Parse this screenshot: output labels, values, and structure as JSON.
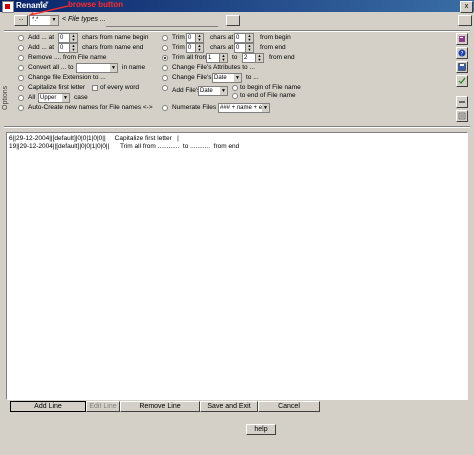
{
  "window": {
    "title": "Rename",
    "title_suffix": "*.*",
    "close": "x"
  },
  "annotation": {
    "text": "browse button"
  },
  "toolbar": {
    "browse_label": "...",
    "file_types_value": "*.*",
    "file_types_label": "< File types ..."
  },
  "options_label": "Options",
  "left_options": [
    {
      "pre": "Add ... at",
      "spin": "0",
      "post": "chars from name begin"
    },
    {
      "pre": "Add ... at",
      "spin": "0",
      "post": "chars from name end"
    },
    {
      "pre": "Remove .... from File name"
    },
    {
      "pre": "Convert all ... to",
      "combo": "",
      "post": "in name"
    },
    {
      "pre": "Change file Extension to ..."
    },
    {
      "pre": "Capitalize first letter",
      "check": "of every word"
    },
    {
      "pre": "All",
      "combo": "Upper",
      "post": "case"
    },
    {
      "pre": "Auto-Create new names for File names <->"
    }
  ],
  "right_options": [
    {
      "pre": "Trim",
      "spin": "0",
      "mid": "chars at",
      "spin2": "0",
      "post": "from begin"
    },
    {
      "pre": "Trim",
      "spin": "0",
      "mid": "chars at",
      "spin2": "0",
      "post": "from end"
    },
    {
      "pre": "Trim all from",
      "spin": "1",
      "mid": "to",
      "spin2": "2",
      "post": "from end"
    },
    {
      "pre": "Change File's Attributes to ..."
    },
    {
      "pre": "Change File's",
      "combo": "Date",
      "post": "to ..."
    },
    {
      "pre": "Add File's",
      "combo": "Date",
      "post1": "to begin of File name",
      "post2": "to end of File name"
    },
    {
      "pre": "Numerate Files",
      "combo": "### + name + ext."
    }
  ],
  "list_rows": [
    "6||29-12-2004||[default]|0|0|1|0|0||     Capitalize first letter   |",
    "19||29-12-2004||[default]|0|0|1|0|0||      Trim all from ............  to ...........  from end"
  ],
  "buttons": {
    "add_line": "Add Line",
    "edit_line": "Edit Line",
    "remove_line": "Remove Line",
    "save_exit": "Save and Exit",
    "cancel": "Cancel",
    "help": "help"
  },
  "colors": {
    "title_start": "#0a246a",
    "title_end": "#3a6ea5",
    "annotation": "#ff2a2a",
    "face": "#d4d0c8"
  },
  "side_icons": [
    "book-icon",
    "question-icon",
    "disk-icon",
    "checklist-icon",
    "minus-icon",
    "properties-icon"
  ]
}
